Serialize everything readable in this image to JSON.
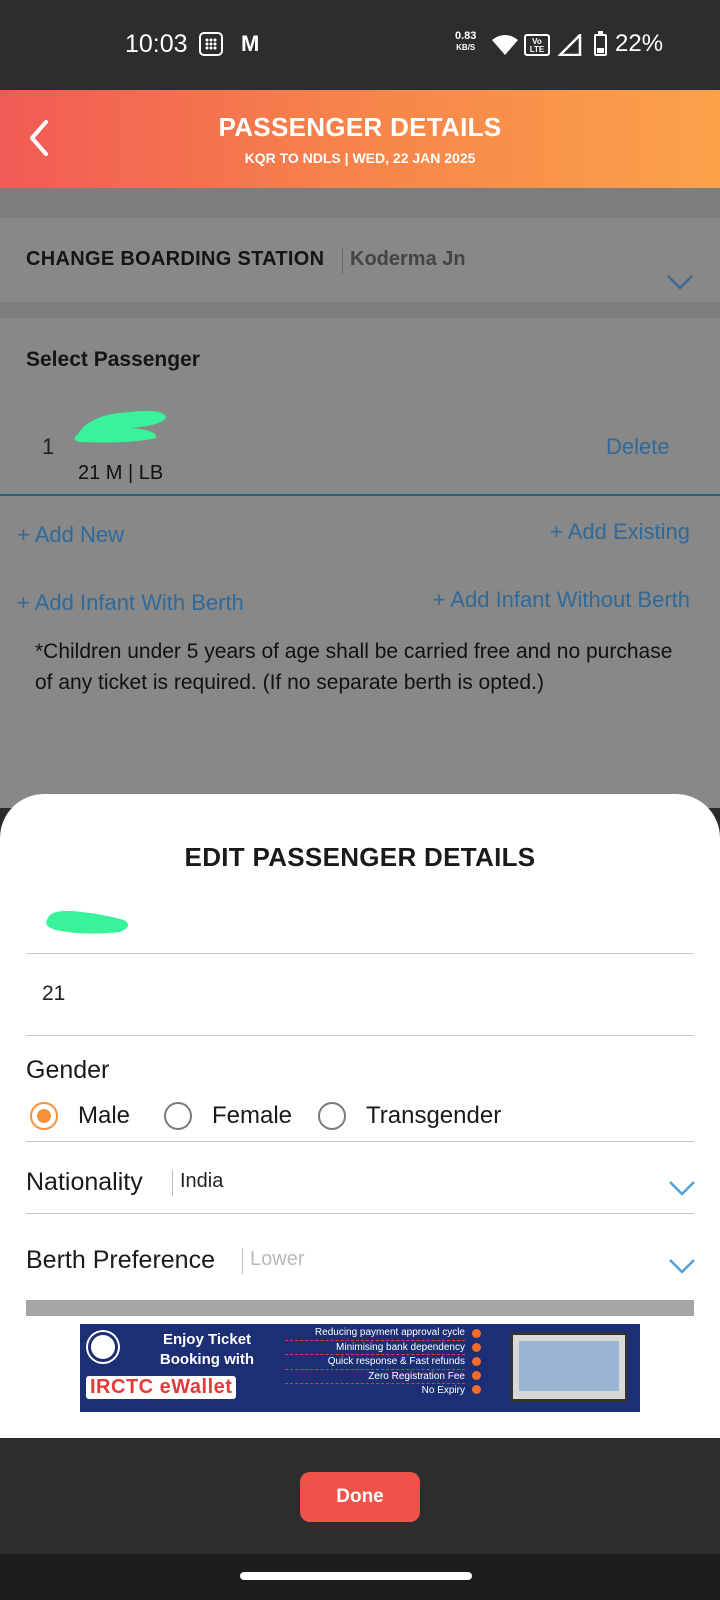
{
  "status_bar": {
    "time": "10:03",
    "mail_glyph": "M",
    "net_speed": "0.83",
    "net_unit": "KB/S",
    "volte": "Vo LTE",
    "battery": "22%"
  },
  "header": {
    "title": "PASSENGER DETAILS",
    "subtitle": "KQR TO NDLS |  WED, 22 JAN  2025"
  },
  "boarding": {
    "label": "CHANGE BOARDING STATION",
    "value": "Koderma Jn"
  },
  "passenger_section": {
    "title": "Select Passenger",
    "passengers": [
      {
        "index": "1",
        "info": "21 M | LB",
        "delete_label": "Delete"
      }
    ],
    "add_new": "+ Add New",
    "add_existing": "+ Add Existing",
    "add_infant_with_berth": "+ Add Infant With Berth",
    "add_infant_without_berth": "+ Add Infant Without Berth",
    "note": "*Children under 5 years of age shall be carried free and no purchase of any ticket is required. (If no separate berth is opted.)"
  },
  "edit_sheet": {
    "title": "EDIT PASSENGER DETAILS",
    "age": "21",
    "gender_label": "Gender",
    "gender_options": [
      "Male",
      "Female",
      "Transgender"
    ],
    "gender_selected": "Male",
    "nationality_label": "Nationality",
    "nationality_value": "India",
    "berth_label": "Berth Preference",
    "berth_value": "Lower"
  },
  "banner": {
    "headline": "Enjoy Ticket Booking with",
    "brand": "IRCTC eWallet",
    "features": [
      "Reducing payment approval cycle",
      "Minimising bank dependency",
      "Quick response & Fast refunds",
      "Zero Registration Fee",
      "No Expiry"
    ]
  },
  "footer": {
    "done_label": "Done"
  },
  "colors": {
    "accent": "#f6923b",
    "link": "#2f6a9a",
    "done": "#f2514a",
    "header_start": "#f15a55",
    "header_end": "#fba24a"
  }
}
